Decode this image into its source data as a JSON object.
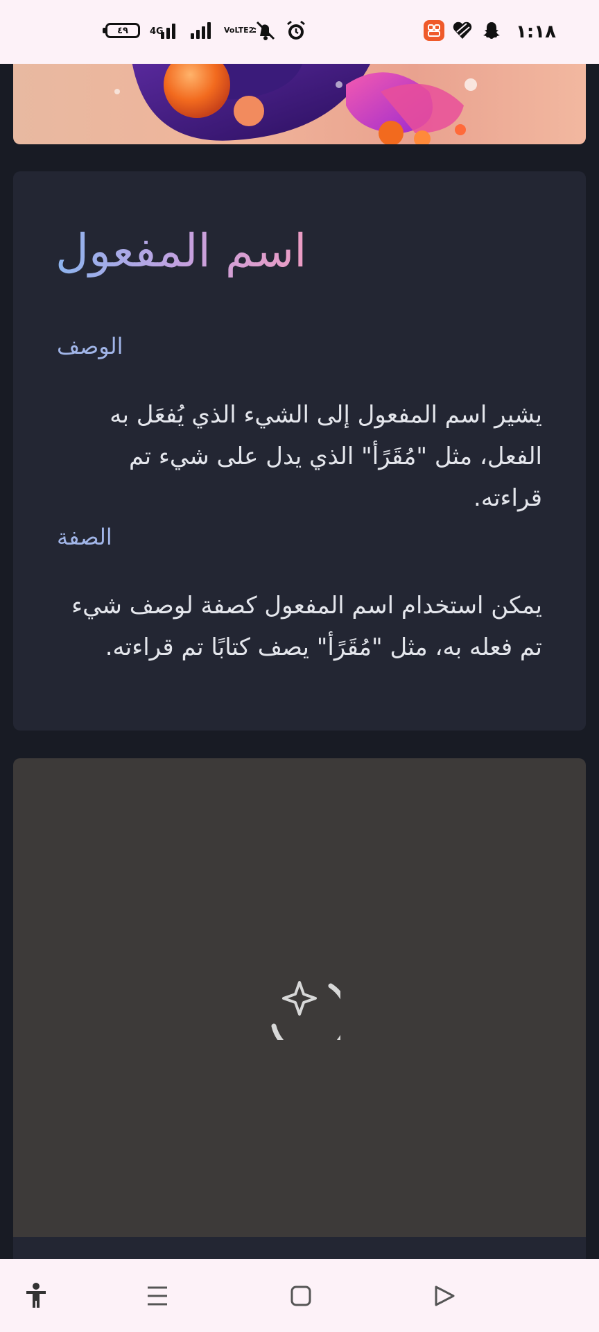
{
  "status_bar": {
    "battery_level": "٤٩",
    "network_type": "4G",
    "volte_label": "VoLTE2",
    "time": "١:١٨"
  },
  "article": {
    "title": "اسم المفعول",
    "sections": [
      {
        "heading": "الوصف",
        "body": "يشير اسم المفعول إلى الشيء الذي يُفعَل به الفعل، مثل \"مُقَرًأ\" الذي يدل على شيء تم قراءته."
      },
      {
        "heading": "الصفة",
        "body": "يمكن استخدام اسم المفعول كصفة لوصف شيء تم فعله به، مثل \"مُقَرًأ\" يصف كتابًا تم قراءته."
      }
    ]
  },
  "image_panel": {
    "state": "loading",
    "icon": "sparkle-spinner-icon"
  },
  "nav_bar": {
    "items": [
      "accessibility-icon",
      "recents-icon",
      "home-icon",
      "back-icon"
    ]
  },
  "colors": {
    "page_bg": "#181b24",
    "card_bg": "#232633",
    "section_label": "#a1b5e8",
    "body_text": "#e4e6ec",
    "image_panel_bg": "#3d3a39",
    "system_bar_bg": "#fdf2f8"
  }
}
